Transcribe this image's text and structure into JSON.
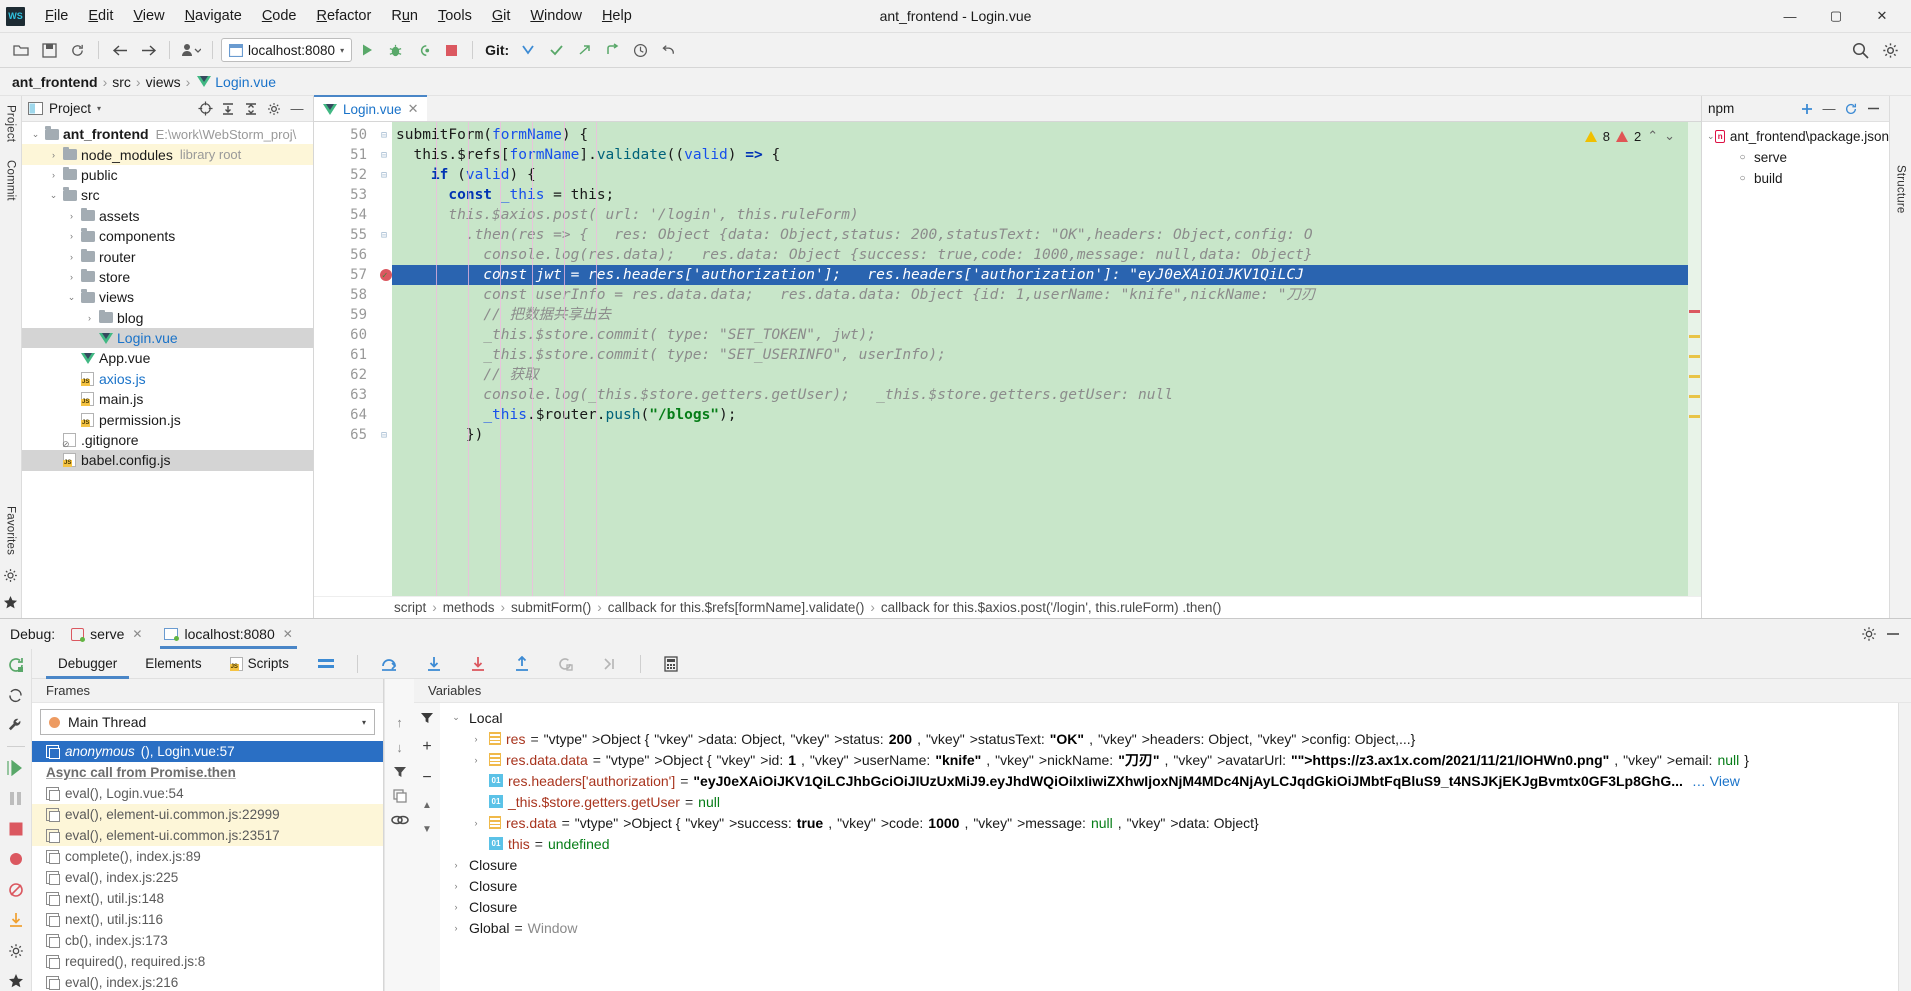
{
  "window": {
    "title": "ant_frontend - Login.vue"
  },
  "menu": {
    "items": [
      {
        "pre": "",
        "mn": "F",
        "post": "ile"
      },
      {
        "pre": "",
        "mn": "E",
        "post": "dit"
      },
      {
        "pre": "",
        "mn": "V",
        "post": "iew"
      },
      {
        "pre": "",
        "mn": "N",
        "post": "avigate"
      },
      {
        "pre": "",
        "mn": "C",
        "post": "ode"
      },
      {
        "pre": "",
        "mn": "R",
        "post": "efactor"
      },
      {
        "pre": "R",
        "mn": "u",
        "post": "n"
      },
      {
        "pre": "",
        "mn": "T",
        "post": "ools"
      },
      {
        "pre": "",
        "mn": "G",
        "post": "it"
      },
      {
        "pre": "",
        "mn": "W",
        "post": "indow"
      },
      {
        "pre": "",
        "mn": "H",
        "post": "elp"
      }
    ],
    "logo": "WS"
  },
  "window_controls": {
    "minimize": "—",
    "maximize": "▢",
    "close": "✕"
  },
  "toolbar": {
    "run_config": "localhost:8080",
    "git_label": "Git:",
    "caret": "▾"
  },
  "breadcrumb": {
    "project": "ant_frontend",
    "parts": [
      "src",
      "views"
    ],
    "file": "Login.vue"
  },
  "left_stripe": {
    "top": [
      "Project"
    ],
    "bottom": [
      "Commit"
    ]
  },
  "right_stripe": {
    "items": [
      "Structure"
    ]
  },
  "left_bottom_stripe": {
    "items": [
      "Favorites"
    ]
  },
  "project_pane": {
    "title": "Project",
    "caret": "▾",
    "tree": [
      {
        "indent": 0,
        "arrow": "⌄",
        "icon": "folder",
        "label": "ant_frontend",
        "hint": "E:\\work\\WebStorm_proj\\",
        "bold": true,
        "style": ""
      },
      {
        "indent": 1,
        "arrow": "›",
        "icon": "folder",
        "label": "node_modules",
        "hint": "library root",
        "bold": false,
        "style": "hl-yellow"
      },
      {
        "indent": 1,
        "arrow": "›",
        "icon": "folder",
        "label": "public",
        "hint": "",
        "bold": false,
        "style": ""
      },
      {
        "indent": 1,
        "arrow": "⌄",
        "icon": "folder",
        "label": "src",
        "hint": "",
        "bold": false,
        "style": ""
      },
      {
        "indent": 2,
        "arrow": "›",
        "icon": "folder",
        "label": "assets",
        "hint": "",
        "bold": false,
        "style": ""
      },
      {
        "indent": 2,
        "arrow": "›",
        "icon": "folder",
        "label": "components",
        "hint": "",
        "bold": false,
        "style": ""
      },
      {
        "indent": 2,
        "arrow": "›",
        "icon": "folder",
        "label": "router",
        "hint": "",
        "bold": false,
        "style": ""
      },
      {
        "indent": 2,
        "arrow": "›",
        "icon": "folder",
        "label": "store",
        "hint": "",
        "bold": false,
        "style": ""
      },
      {
        "indent": 2,
        "arrow": "⌄",
        "icon": "folder",
        "label": "views",
        "hint": "",
        "bold": false,
        "style": ""
      },
      {
        "indent": 3,
        "arrow": "›",
        "icon": "folder",
        "label": "blog",
        "hint": "",
        "bold": false,
        "style": ""
      },
      {
        "indent": 3,
        "arrow": "",
        "icon": "vue",
        "label": "Login.vue",
        "hint": "",
        "bold": false,
        "style": "sel-gray blue-txt"
      },
      {
        "indent": 2,
        "arrow": "",
        "icon": "vue",
        "label": "App.vue",
        "hint": "",
        "bold": false,
        "style": ""
      },
      {
        "indent": 2,
        "arrow": "",
        "icon": "js",
        "label": "axios.js",
        "hint": "",
        "bold": false,
        "style": "blue-txt"
      },
      {
        "indent": 2,
        "arrow": "",
        "icon": "js",
        "label": "main.js",
        "hint": "",
        "bold": false,
        "style": ""
      },
      {
        "indent": 2,
        "arrow": "",
        "icon": "js",
        "label": "permission.js",
        "hint": "",
        "bold": false,
        "style": ""
      },
      {
        "indent": 1,
        "arrow": "",
        "icon": "git",
        "label": ".gitignore",
        "hint": "",
        "bold": false,
        "style": ""
      },
      {
        "indent": 1,
        "arrow": "",
        "icon": "js",
        "label": "babel.config.js",
        "hint": "",
        "bold": false,
        "style": "sel-gray"
      }
    ]
  },
  "editor": {
    "tab": {
      "label": "Login.vue",
      "close": "✕"
    },
    "inspector": {
      "warn_count": "8",
      "error_count": "2",
      "up": "⌃",
      "down": "⌄"
    },
    "first_line_no": 50,
    "lines": [
      {
        "no": 50,
        "fold": true,
        "bp": false,
        "active": false
      },
      {
        "no": 51,
        "fold": true,
        "bp": false,
        "active": false
      },
      {
        "no": 52,
        "fold": true,
        "bp": false,
        "active": false
      },
      {
        "no": 53,
        "fold": false,
        "bp": false,
        "active": false
      },
      {
        "no": 54,
        "fold": false,
        "bp": false,
        "active": false
      },
      {
        "no": 55,
        "fold": true,
        "bp": false,
        "active": false
      },
      {
        "no": 56,
        "fold": false,
        "bp": false,
        "active": false
      },
      {
        "no": 57,
        "fold": false,
        "bp": true,
        "active": true
      },
      {
        "no": 58,
        "fold": false,
        "bp": false,
        "active": false
      },
      {
        "no": 59,
        "fold": false,
        "bp": false,
        "active": false
      },
      {
        "no": 60,
        "fold": false,
        "bp": false,
        "active": false
      },
      {
        "no": 61,
        "fold": false,
        "bp": false,
        "active": false
      },
      {
        "no": 62,
        "fold": false,
        "bp": false,
        "active": false
      },
      {
        "no": 63,
        "fold": false,
        "bp": false,
        "active": false
      },
      {
        "no": 64,
        "fold": false,
        "bp": false,
        "active": false
      },
      {
        "no": 65,
        "fold": true,
        "bp": false,
        "active": false
      }
    ],
    "code_text": [
      "submitForm(formName) {",
      "  this.$refs[formName].validate((valid) => {",
      "    if (valid) {",
      "      const _this = this;",
      "      this.$axios.post( url: '/login', this.ruleForm)",
      "        .then(res => {   res: Object {data: Object,status: 200,statusText: \"OK\",headers: Object,config: O",
      "          console.log(res.data);   res.data: Object {success: true,code: 1000,message: null,data: Object}",
      "          const jwt = res.headers['authorization'];   res.headers['authorization']: \"eyJ0eXAiOiJKV1QiLCJ",
      "          const userInfo = res.data.data;   res.data.data: Object {id: 1,userName: \"knife\",nickName: \"刀刃",
      "          // 把数据共享出去",
      "          _this.$store.commit( type: \"SET_TOKEN\", jwt);",
      "          _this.$store.commit( type: \"SET_USERINFO\", userInfo);",
      "          // 获取",
      "          console.log(_this.$store.getters.getUser);   _this.$store.getters.getUser: null",
      "          _this.$router.push(\"/blogs\");",
      "        })"
    ],
    "breadcrumb_bar": [
      "script",
      "methods",
      "submitForm()",
      "callback for this.$refs[formName].validate()",
      "callback for this.$axios.post('/login', this.ruleForm) .then()"
    ]
  },
  "npm_pane": {
    "title": "npm",
    "icons": [
      "+",
      "—",
      "⟳",
      "⚙"
    ],
    "items": [
      {
        "indent": 0,
        "arrow": "⌄",
        "icon": "npm",
        "label": "ant_frontend\\package.json"
      },
      {
        "indent": 1,
        "arrow": "",
        "icon": "bullet",
        "label": "serve"
      },
      {
        "indent": 1,
        "arrow": "",
        "icon": "bullet",
        "label": "build"
      }
    ]
  },
  "debug": {
    "header_label": "Debug:",
    "tabs": [
      {
        "label": "serve",
        "icon": "server",
        "active": false,
        "close": "✕"
      },
      {
        "label": "localhost:8080",
        "icon": "browser",
        "active": true,
        "close": "✕"
      }
    ],
    "header_right": [
      "⚙",
      "—"
    ],
    "inner_tabs": [
      {
        "label": "Debugger",
        "active": true,
        "icon": ""
      },
      {
        "label": "Elements",
        "active": false,
        "icon": ""
      },
      {
        "label": "Scripts",
        "active": false,
        "icon": "js"
      }
    ],
    "frames": {
      "title": "Frames",
      "thread": "Main Thread",
      "thread_caret": "▾",
      "up": "↑",
      "down": "↓",
      "list": [
        {
          "text": "anonymous(), Login.vue:57",
          "fn": "anonymous",
          "rest": "(), Login.vue:57",
          "kind": "selected"
        },
        {
          "text": "Async call from Promise.then",
          "kind": "async"
        },
        {
          "text": "eval(), Login.vue:54",
          "kind": "normal"
        },
        {
          "text": "eval(), element-ui.common.js:22999",
          "kind": "hl"
        },
        {
          "text": "eval(), element-ui.common.js:23517",
          "kind": "hl"
        },
        {
          "text": "complete(), index.js:89",
          "kind": "normal"
        },
        {
          "text": "eval(), index.js:225",
          "kind": "normal"
        },
        {
          "text": "next(), util.js:148",
          "kind": "normal"
        },
        {
          "text": "next(), util.js:116",
          "kind": "normal"
        },
        {
          "text": "cb(), index.js:173",
          "kind": "normal"
        },
        {
          "text": "required(), required.js:8",
          "kind": "normal"
        },
        {
          "text": "eval(), index.js:216",
          "kind": "normal"
        }
      ]
    },
    "variables": {
      "title": "Variables",
      "rows": [
        {
          "indent": 0,
          "arrow": "⌄",
          "icon": "none",
          "name": "Local",
          "eq": "",
          "value": "",
          "kind": "scope"
        },
        {
          "indent": 1,
          "arrow": "›",
          "icon": "obj",
          "name": "res",
          "eq": " = ",
          "value": "Object {data: Object,status: 200,statusText: \"OK\",headers: Object,config: Object,...}",
          "kind": "obj"
        },
        {
          "indent": 1,
          "arrow": "›",
          "icon": "obj",
          "name": "res.data.data",
          "eq": " = ",
          "value": "Object {id: 1,userName: \"knife\",nickName: \"刀刃\",avatarUrl: \"https://z3.ax1x.com/2021/11/21/IOHWn0.png\",email: null}",
          "kind": "obj"
        },
        {
          "indent": 1,
          "arrow": "",
          "icon": "prim",
          "name": "res.headers['authorization']",
          "eq": " = ",
          "value": "\"eyJ0eXAiOiJKV1QiLCJhbGciOiJIUzUxMiJ9.eyJhdWQiOiIxIiwiZXhwIjoxNjM4MDc4NjAyLCJqdGkiOiJMbtFqBluS9_t4NSJKjEKJgBvmtx0GF3Lp8GhG...",
          "kind": "prim",
          "link": "View"
        },
        {
          "indent": 1,
          "arrow": "",
          "icon": "prim",
          "name": "_this.$store.getters.getUser",
          "eq": " = ",
          "value": "null",
          "kind": "null"
        },
        {
          "indent": 1,
          "arrow": "›",
          "icon": "obj",
          "name": "res.data",
          "eq": " = ",
          "value": "Object {success: true,code: 1000,message: null,data: Object}",
          "kind": "obj"
        },
        {
          "indent": 1,
          "arrow": "",
          "icon": "prim",
          "name": "this",
          "eq": " = ",
          "value": "undefined",
          "kind": "undef"
        },
        {
          "indent": 0,
          "arrow": "›",
          "icon": "none",
          "name": "Closure",
          "eq": "",
          "value": "",
          "kind": "scope"
        },
        {
          "indent": 0,
          "arrow": "›",
          "icon": "none",
          "name": "Closure",
          "eq": "",
          "value": "",
          "kind": "scope"
        },
        {
          "indent": 0,
          "arrow": "›",
          "icon": "none",
          "name": "Closure",
          "eq": "",
          "value": "",
          "kind": "scope"
        },
        {
          "indent": 0,
          "arrow": "›",
          "icon": "none",
          "name": "Global",
          "eq": " = ",
          "value": "Window",
          "kind": "scope"
        }
      ]
    },
    "rail_icons": [
      "rerun",
      "refresh",
      "settings",
      "resume",
      "pause",
      "stop",
      "mute-breakpoints",
      "breakpoints",
      "force-step",
      "view-breakpoints",
      "settings2",
      "pin"
    ],
    "step_icons": [
      "step-over",
      "step-into",
      "force-step-into",
      "step-out",
      "run-to-cursor",
      "evaluate",
      "calculator"
    ]
  },
  "colors": {
    "accent": "#4a86c7",
    "selection": "#2a64b0",
    "code_bg": "#c8e6c9",
    "warn": "#f0c000",
    "error": "#e05555",
    "vue_green": "#41b883"
  }
}
